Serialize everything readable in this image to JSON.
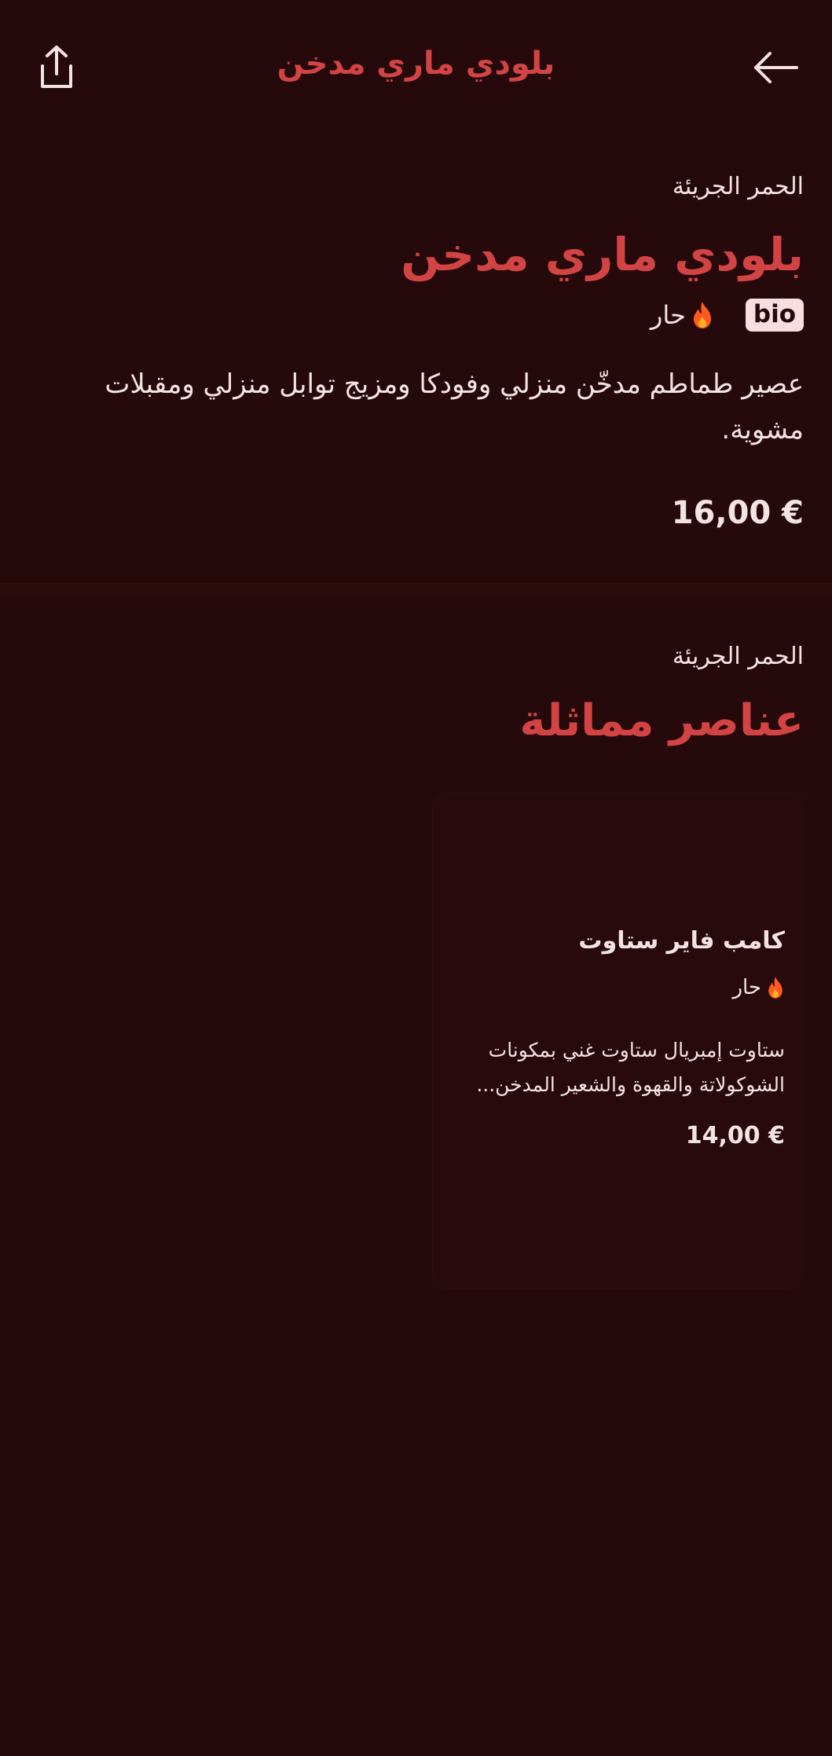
{
  "header": {
    "title": "بلودي ماري مدخن",
    "share_icon": "share-icon",
    "back_icon": "arrow-left-icon"
  },
  "product": {
    "category": "الحمر الجريئة",
    "title": "بلودي ماري مدخن",
    "badge": "bio",
    "spicy_label": "حار",
    "description": "عصير طماطم مدخّن منزلي وفودكا ومزيج توابل منزلي ومقبلات مشوية.",
    "price": "16,00 €"
  },
  "similar": {
    "category": "الحمر الجريئة",
    "title": "عناصر مماثلة",
    "items": [
      {
        "title": "كامب فاير ستاوت",
        "spicy_label": "حار",
        "description": "ستاوت إمبريال ستاوت غني بمكونات الشوكولاتة والقهوة والشعير المدخن...",
        "price": "14,00 €"
      }
    ]
  },
  "colors": {
    "background": "#26090b",
    "accent": "#d24444",
    "text": "#f3e3e3",
    "flame": "#ff5a1f"
  }
}
